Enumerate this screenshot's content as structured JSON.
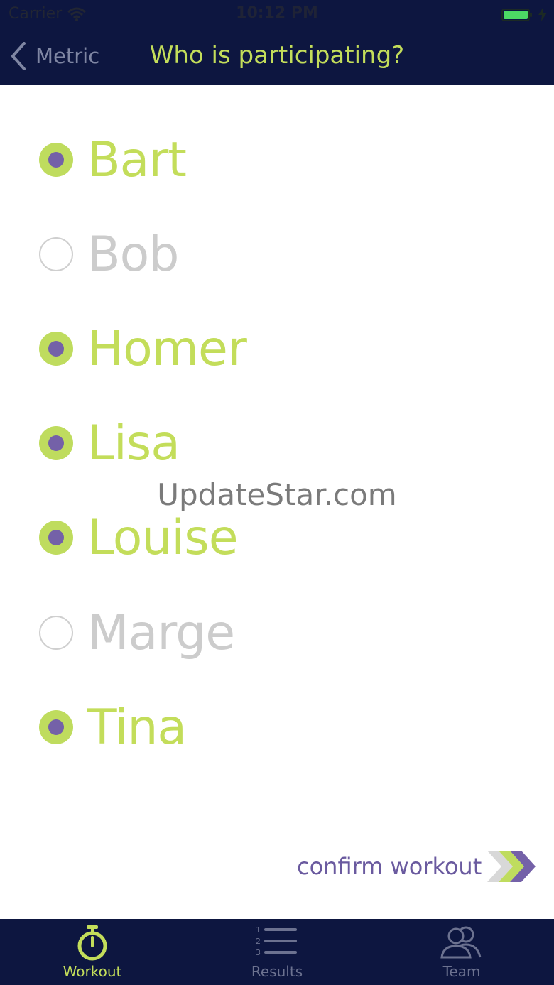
{
  "status_bar": {
    "carrier": "Carrier",
    "time": "10:12 PM"
  },
  "nav": {
    "back_label": "Metric",
    "title": "Who is participating?"
  },
  "participants": [
    {
      "name": "Bart",
      "selected": true
    },
    {
      "name": "Bob",
      "selected": false
    },
    {
      "name": "Homer",
      "selected": true
    },
    {
      "name": "Lisa",
      "selected": true
    },
    {
      "name": "Louise",
      "selected": true
    },
    {
      "name": "Marge",
      "selected": false
    },
    {
      "name": "Tina",
      "selected": true
    }
  ],
  "watermark": "UpdateStar.com",
  "confirm": {
    "label": "confirm workout"
  },
  "tabs": [
    {
      "label": "Workout",
      "icon": "stopwatch-icon",
      "active": true
    },
    {
      "label": "Results",
      "icon": "ranked-list-icon",
      "active": false
    },
    {
      "label": "Team",
      "icon": "team-icon",
      "active": false
    }
  ],
  "colors": {
    "nav_background": "#0d1640",
    "accent_green": "#c3dd5a",
    "accent_purple": "#7461a8",
    "unselected_gray": "#cccccc"
  }
}
